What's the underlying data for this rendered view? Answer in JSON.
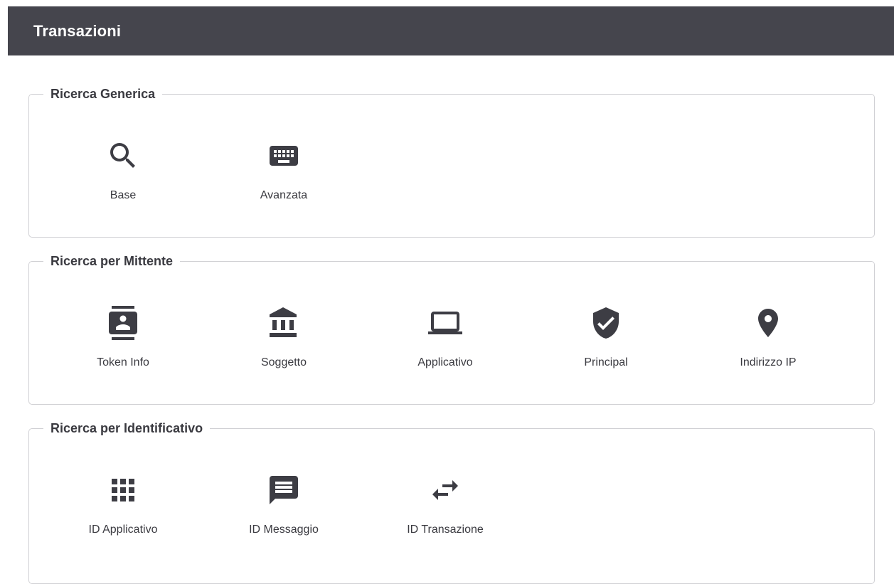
{
  "header": {
    "title": "Transazioni"
  },
  "sections": [
    {
      "title": "Ricerca Generica",
      "items": [
        {
          "label": "Base",
          "icon": "search-icon"
        },
        {
          "label": "Avanzata",
          "icon": "keyboard-icon"
        }
      ]
    },
    {
      "title": "Ricerca per Mittente",
      "items": [
        {
          "label": "Token Info",
          "icon": "contacts-icon"
        },
        {
          "label": "Soggetto",
          "icon": "bank-icon"
        },
        {
          "label": "Applicativo",
          "icon": "laptop-icon"
        },
        {
          "label": "Principal",
          "icon": "verified-shield-icon"
        },
        {
          "label": "Indirizzo IP",
          "icon": "location-pin-icon"
        }
      ]
    },
    {
      "title": "Ricerca per Identificativo",
      "items": [
        {
          "label": "ID Applicativo",
          "icon": "apps-grid-icon"
        },
        {
          "label": "ID Messaggio",
          "icon": "message-icon"
        },
        {
          "label": "ID Transazione",
          "icon": "swap-arrows-icon"
        }
      ]
    }
  ],
  "colors": {
    "header_bg": "#45454d",
    "icon": "#3d3d44",
    "border": "#d0d0d4"
  }
}
